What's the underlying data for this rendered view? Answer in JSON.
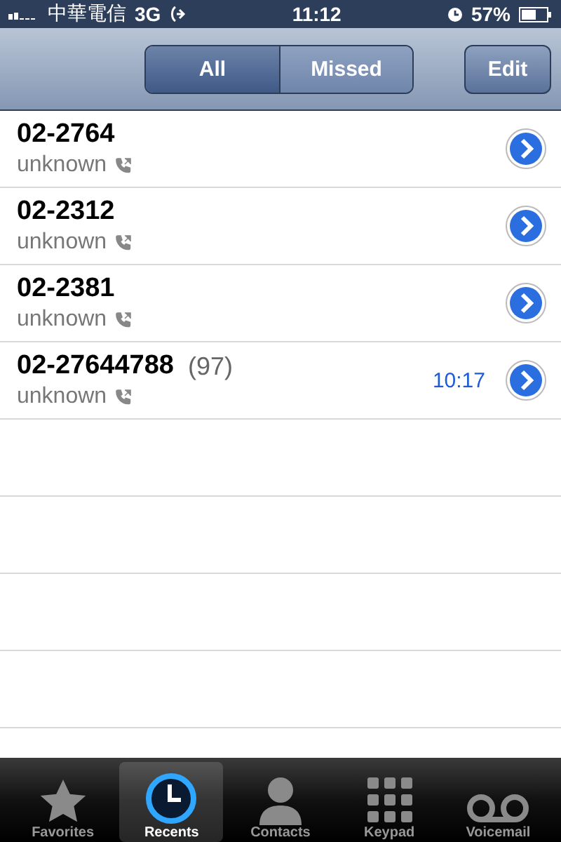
{
  "status_bar": {
    "carrier": "中華電信",
    "network": "3G",
    "time": "11:12",
    "battery": "57%"
  },
  "segments": [
    {
      "label": "All",
      "selected": true
    },
    {
      "label": "Missed",
      "selected": false
    }
  ],
  "edit_button": "Edit",
  "calls": [
    {
      "number": "02-2764",
      "label": "unknown"
    },
    {
      "number": "02-2312",
      "label": "unknown"
    },
    {
      "number": "02-2381",
      "label": "unknown"
    },
    {
      "number": "02-27644788",
      "count": "(97)",
      "label": "unknown",
      "time": "10:17"
    }
  ],
  "tab_bar": [
    {
      "label": "Favorites",
      "kind": "star",
      "selected": false
    },
    {
      "label": "Recents",
      "kind": "clock",
      "selected": true
    },
    {
      "label": "Contacts",
      "kind": "person",
      "selected": false
    },
    {
      "label": "Keypad",
      "kind": "keypad",
      "selected": false
    },
    {
      "label": "Voicemail",
      "kind": "voicemail",
      "selected": false
    }
  ]
}
